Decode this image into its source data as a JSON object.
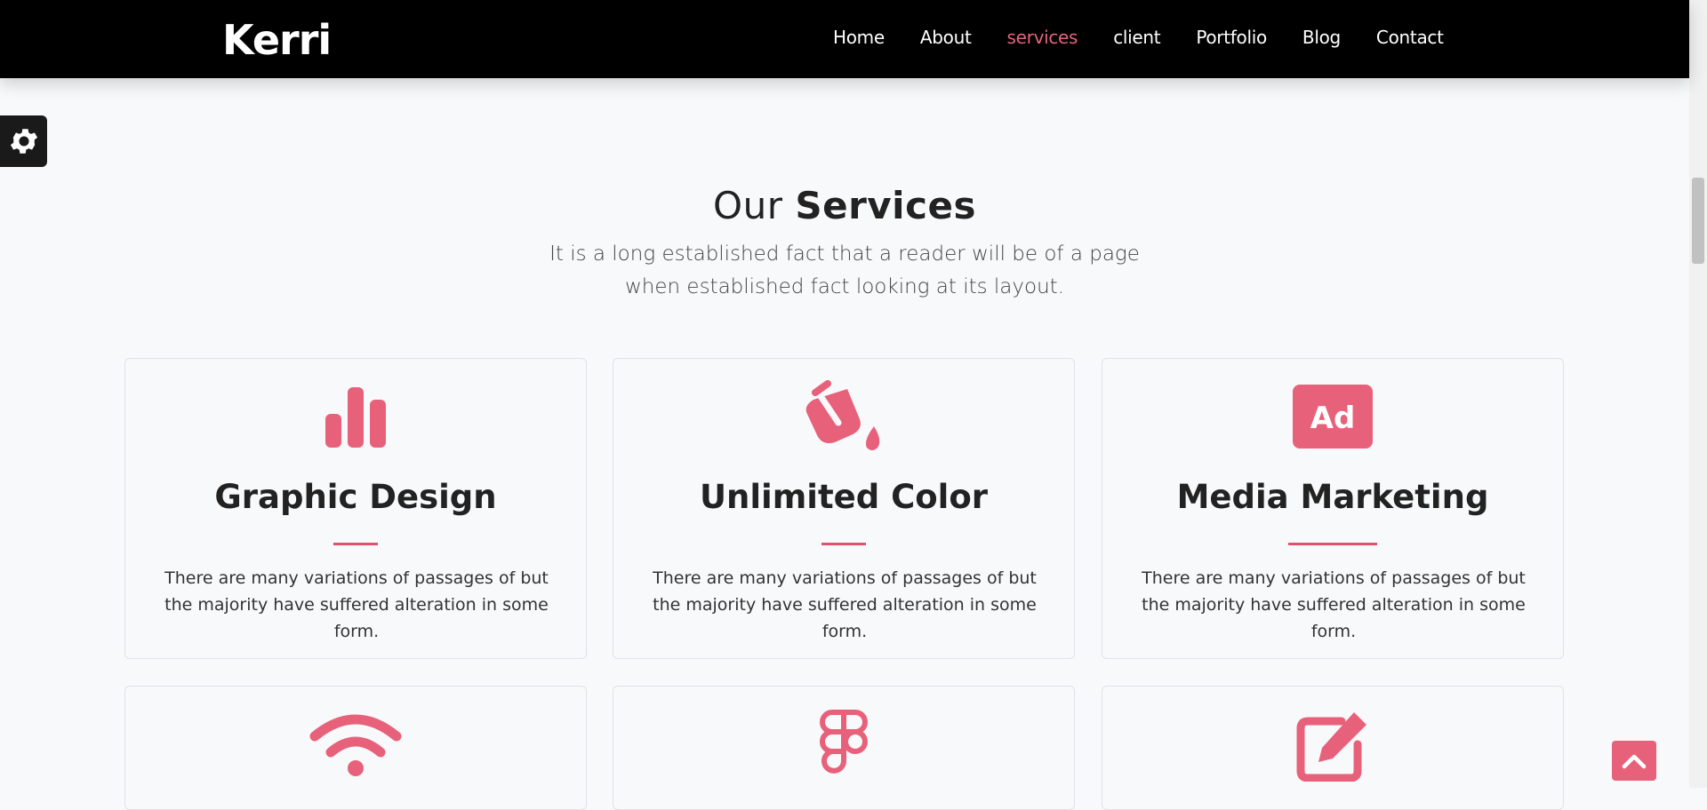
{
  "brand": "Kerri",
  "nav": [
    {
      "label": "Home",
      "active": false
    },
    {
      "label": "About",
      "active": false
    },
    {
      "label": "services",
      "active": true
    },
    {
      "label": "client",
      "active": false
    },
    {
      "label": "Portfolio",
      "active": false
    },
    {
      "label": "Blog",
      "active": false
    },
    {
      "label": "Contact",
      "active": false
    }
  ],
  "section": {
    "title_light": "Our",
    "title_bold": "Services",
    "subtitle": "It is a long established fact that a reader will be of a page when established fact looking at its layout."
  },
  "services": [
    {
      "icon": "bar-chart-icon",
      "title": "Graphic Design",
      "desc": "There are many variations of passages of but the majority have suffered alteration in some form."
    },
    {
      "icon": "paint-bucket-icon",
      "title": "Unlimited Color",
      "desc": "There are many variations of passages of but the majority have suffered alteration in some form."
    },
    {
      "icon": "ad-icon",
      "title": "Media Marketing",
      "desc": "There are many variations of passages of but the majority have suffered alteration in some form."
    },
    {
      "icon": "wifi-icon",
      "title": "",
      "desc": ""
    },
    {
      "icon": "figma-icon",
      "title": "",
      "desc": ""
    },
    {
      "icon": "edit-icon",
      "title": "",
      "desc": ""
    }
  ],
  "colors": {
    "accent": "#e8617a",
    "nav_bg": "#000000",
    "page_bg": "#f8f9fb"
  }
}
